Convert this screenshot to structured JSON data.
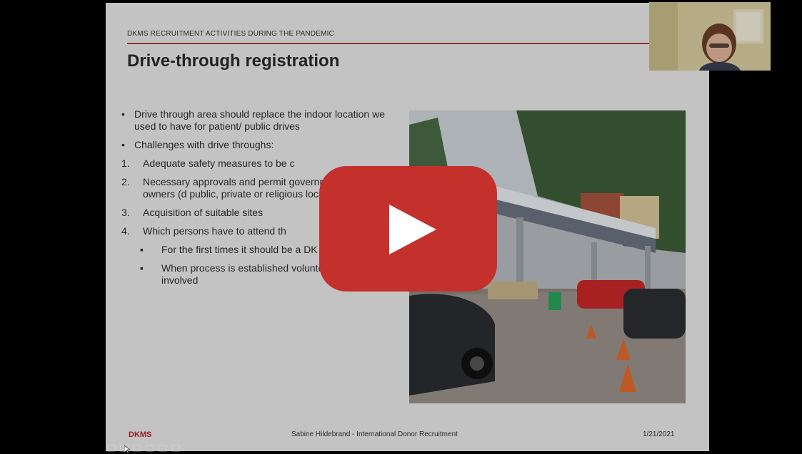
{
  "slide": {
    "header": "DKMS RECRUITMENT ACTIVITIES DURING THE PANDEMIC",
    "title": "Drive-through registration",
    "bullets": [
      {
        "marker": "•",
        "text": "Drive through area should replace the indoor location we used to have for patient/ public drives"
      },
      {
        "marker": "•",
        "text": "Challenges with drive throughs:"
      },
      {
        "marker": "1.",
        "text": "Adequate safety measures to be c"
      },
      {
        "marker": "2.",
        "text": "Necessary approvals and permit government, mayors, owners (d public, private or religious locatio"
      },
      {
        "marker": "3.",
        "text": "Acquisition of suitable sites"
      },
      {
        "marker": "4.",
        "text": "Which persons have to attend th"
      },
      {
        "marker": "▪",
        "text": "For the first times it should be a DK coordinator",
        "sub": true
      },
      {
        "marker": "▪",
        "text": "When process is established volunteers can be involved",
        "sub": true
      }
    ],
    "footer": {
      "brand": "DKMS",
      "presenter": "Sabine Hildebrand - International Donor Recruitment",
      "date": "1/21/2021"
    }
  },
  "player": {
    "play_button_color": "#c4302b",
    "play_icon": "play-icon"
  },
  "colors": {
    "accent": "#b23a3a",
    "brand": "#b4232f"
  }
}
